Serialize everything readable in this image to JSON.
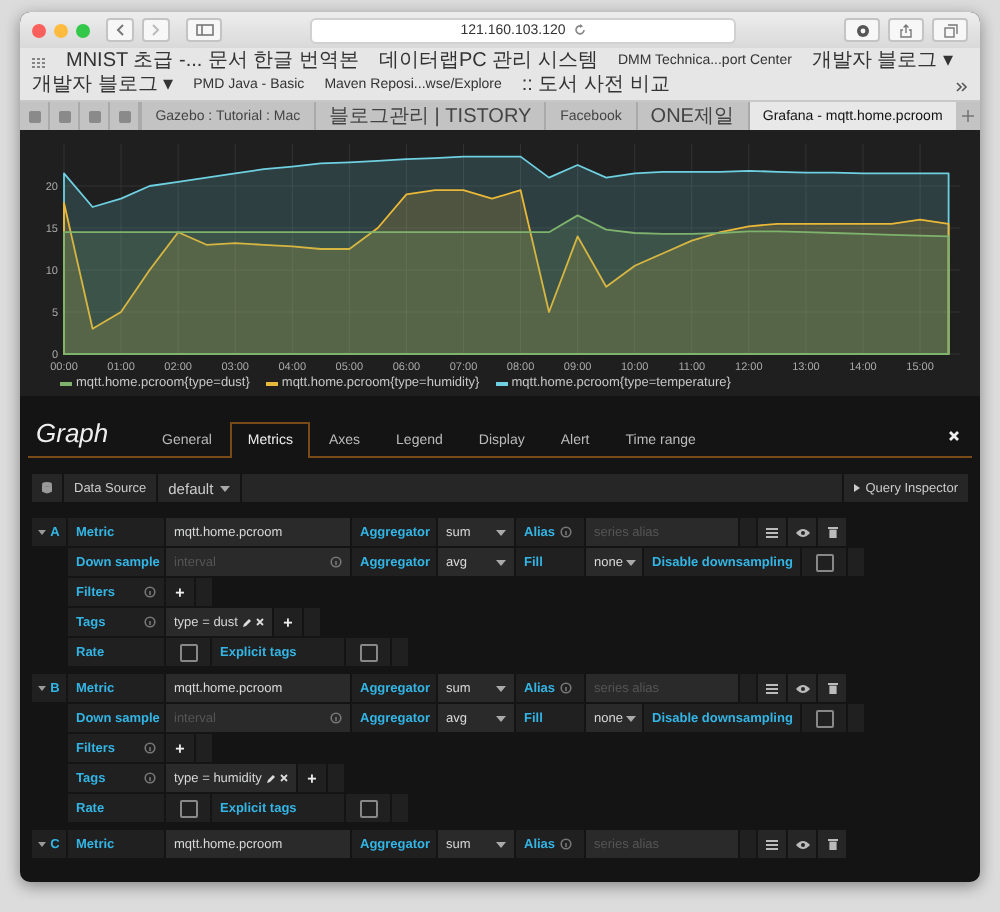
{
  "browser": {
    "url": "121.160.103.120",
    "bookmarks": [
      "MNIST 초급 -... 문서 한글 번역본",
      "데이터랩PC 관리 시스템",
      "DMM Technica...port Center",
      "개발자 블로그 ▾",
      "개발자 블로그 ▾",
      "PMD Java - Basic",
      "Maven Reposi...wse/Explore",
      ":: 도서 사전 비교"
    ],
    "tabs": [
      {
        "label": "Gazebo : Tutorial : Mac",
        "selected": false
      },
      {
        "label": "블로그관리 | TISTORY",
        "selected": false
      },
      {
        "label": "Facebook",
        "selected": false
      },
      {
        "label": "ONE제일",
        "selected": false
      },
      {
        "label": "Grafana - mqtt.home.pcroom",
        "selected": true
      }
    ]
  },
  "panel": {
    "chart_data": {
      "type": "area",
      "x": [
        0,
        0.5,
        1,
        1.5,
        2,
        2.5,
        3,
        3.5,
        4,
        4.5,
        5,
        5.5,
        6,
        6.5,
        7,
        7.5,
        8,
        8.5,
        9,
        9.5,
        10,
        10.5,
        11,
        11.5,
        12,
        12.5,
        13,
        13.5,
        14,
        14.5,
        15,
        15.5
      ],
      "xlim": [
        0,
        15.7
      ],
      "ylim": [
        0,
        25
      ],
      "grid": true,
      "xticks": [
        {
          "value": 0,
          "label": "00:00"
        },
        {
          "value": 1,
          "label": "01:00"
        },
        {
          "value": 2,
          "label": "02:00"
        },
        {
          "value": 3,
          "label": "03:00"
        },
        {
          "value": 4,
          "label": "04:00"
        },
        {
          "value": 5,
          "label": "05:00"
        },
        {
          "value": 6,
          "label": "06:00"
        },
        {
          "value": 7,
          "label": "07:00"
        },
        {
          "value": 8,
          "label": "08:00"
        },
        {
          "value": 9,
          "label": "09:00"
        },
        {
          "value": 10,
          "label": "10:00"
        },
        {
          "value": 11,
          "label": "11:00"
        },
        {
          "value": 12,
          "label": "12:00"
        },
        {
          "value": 13,
          "label": "13:00"
        },
        {
          "value": 14,
          "label": "14:00"
        },
        {
          "value": 15,
          "label": "15:00"
        }
      ],
      "yticks": [
        0,
        5,
        10,
        15,
        20
      ],
      "series": [
        {
          "name": "mqtt.home.pcroom{type=dust}",
          "color": "#7eb26d",
          "values": [
            14.5,
            14.5,
            14.5,
            14.5,
            14.5,
            14.5,
            14.5,
            14.5,
            14.5,
            14.5,
            14.5,
            14.5,
            14.5,
            14.5,
            14.5,
            14.5,
            14.5,
            14.5,
            16.5,
            14.8,
            14.4,
            14.3,
            14.3,
            14.4,
            14.6,
            14.6,
            14.5,
            14.4,
            14.3,
            14.2,
            14.1,
            14.0
          ]
        },
        {
          "name": "mqtt.home.pcroom{type=humidity}",
          "color": "#eab839",
          "values": [
            18,
            3,
            5,
            10,
            14.5,
            13,
            13.2,
            13,
            12.8,
            12.5,
            12.5,
            15,
            19,
            19.5,
            19.5,
            18.5,
            19.5,
            5,
            14,
            8,
            10.5,
            12,
            13.5,
            14.5,
            15.2,
            15.5,
            15.5,
            15.5,
            15.5,
            15.5,
            16,
            15.5
          ]
        },
        {
          "name": "mqtt.home.pcroom{type=temperature}",
          "color": "#6ed0e0",
          "values": [
            21.5,
            17.5,
            18.5,
            20,
            20.5,
            21,
            21.5,
            22,
            22.3,
            22.7,
            22.8,
            23,
            23.2,
            23.3,
            23.5,
            23.5,
            23.5,
            21,
            22.5,
            21,
            21.5,
            21.7,
            21.7,
            21.7,
            21.8,
            21.7,
            21.6,
            21.6,
            21.5,
            21.5,
            21.5,
            21.5
          ]
        }
      ]
    }
  },
  "editor": {
    "title": "Graph",
    "tabs": [
      {
        "label": "General",
        "selected": false
      },
      {
        "label": "Metrics",
        "selected": true
      },
      {
        "label": "Axes",
        "selected": false
      },
      {
        "label": "Legend",
        "selected": false
      },
      {
        "label": "Display",
        "selected": false
      },
      {
        "label": "Alert",
        "selected": false
      },
      {
        "label": "Time range",
        "selected": false
      }
    ],
    "data_source": {
      "label": "Data Source",
      "value": "default"
    },
    "query_inspector": "Query Inspector"
  },
  "queries": [
    {
      "letter": "A",
      "expanded": true,
      "rows": [
        {
          "kind": "metric",
          "label": "Metric",
          "value": "mqtt.home.pcroom",
          "aggregator_label": "Aggregator",
          "aggregator": "sum",
          "alias_label": "Alias",
          "alias_placeholder": "series alias"
        },
        {
          "kind": "downsample",
          "label": "Down sample",
          "placeholder": "interval",
          "aggregator_label": "Aggregator",
          "aggregator": "avg",
          "fill_label": "Fill",
          "fill": "none",
          "disable_label": "Disable downsampling",
          "disable_checked": false
        },
        {
          "kind": "filters",
          "label": "Filters",
          "add": "+"
        },
        {
          "kind": "tags",
          "label": "Tags",
          "tags": [
            "type = dust"
          ],
          "add": "+"
        },
        {
          "kind": "rate",
          "label": "Rate",
          "rate_checked": false,
          "explicit_label": "Explicit tags",
          "explicit_checked": false
        }
      ]
    },
    {
      "letter": "B",
      "expanded": true,
      "rows": [
        {
          "kind": "metric",
          "label": "Metric",
          "value": "mqtt.home.pcroom",
          "aggregator_label": "Aggregator",
          "aggregator": "sum",
          "alias_label": "Alias",
          "alias_placeholder": "series alias"
        },
        {
          "kind": "downsample",
          "label": "Down sample",
          "placeholder": "interval",
          "aggregator_label": "Aggregator",
          "aggregator": "avg",
          "fill_label": "Fill",
          "fill": "none",
          "disable_label": "Disable downsampling",
          "disable_checked": false
        },
        {
          "kind": "filters",
          "label": "Filters",
          "add": "+"
        },
        {
          "kind": "tags",
          "label": "Tags",
          "tags": [
            "type = humidity"
          ],
          "add": "+"
        },
        {
          "kind": "rate",
          "label": "Rate",
          "rate_checked": false,
          "explicit_label": "Explicit tags",
          "explicit_checked": false
        }
      ]
    },
    {
      "letter": "C",
      "expanded": true,
      "rows": [
        {
          "kind": "metric",
          "label": "Metric",
          "value": "mqtt.home.pcroom",
          "aggregator_label": "Aggregator",
          "aggregator": "sum",
          "alias_label": "Alias",
          "alias_placeholder": "series alias"
        }
      ]
    }
  ]
}
